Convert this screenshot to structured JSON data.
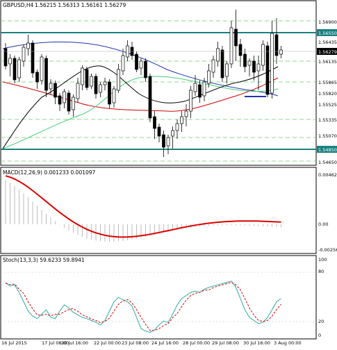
{
  "window": {
    "title": "GBPUSD,H4",
    "ohlc": "1.56215 1.56313 1.56161 1.56279"
  },
  "price_axis": {
    "labels": [
      "1.56900",
      "1.56550",
      "1.56435",
      "1.56279",
      "1.56135",
      "1.55865",
      "1.55820",
      "1.55525",
      "1.55335",
      "1.55070",
      "1.54850",
      "1.54650"
    ],
    "current": "1.56279"
  },
  "macd": {
    "title": "MACD(12,26,9) 0.001233 0.001097",
    "axis": [
      "0.004623",
      "0.00",
      "-0.00256"
    ]
  },
  "stoch": {
    "title": "Stoch(13,3,3) 59.6233 59.8941",
    "axis": [
      "100",
      "80",
      "20",
      "0"
    ]
  },
  "time_axis": [
    "16 Jul 2015",
    "17 Jul 08:00",
    "20 Jul 16:00",
    "22 Jul 00:00",
    "23 Jul 08:00",
    "24 Jul 16:00",
    "28 Jul 00:00",
    "29 Jul 08:00",
    "30 Jul 16:00",
    "3 Aug 00:00"
  ],
  "colors": {
    "bull": "#ffffff",
    "bear": "#000000",
    "level": "#1a8080",
    "ma_fast": "#000000",
    "ma_red": "#cc0000",
    "ma_blue": "#2233aa",
    "ma_green": "#44cc77",
    "macd_signal": "#dd0000",
    "stoch_main": "#2aa9a0",
    "stoch_signal": "#dd0000"
  }
}
